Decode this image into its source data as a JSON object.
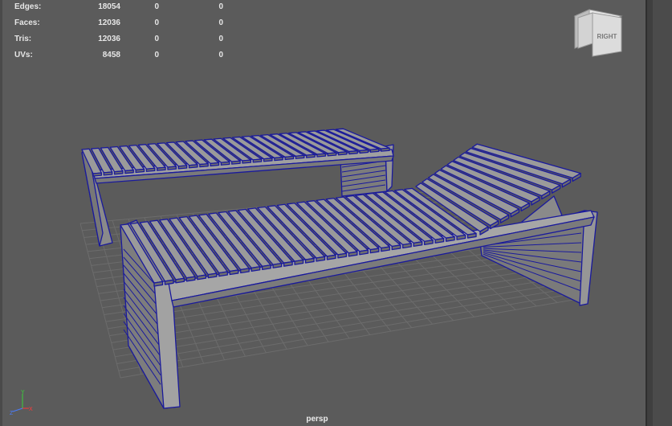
{
  "hud": {
    "rows": [
      {
        "label": "Edges:",
        "v1": "18054",
        "v2": "0",
        "v3": "0"
      },
      {
        "label": "Faces:",
        "v1": "12036",
        "v2": "0",
        "v3": "0"
      },
      {
        "label": "Tris:",
        "v1": "12036",
        "v2": "0",
        "v3": "0"
      },
      {
        "label": "UVs:",
        "v1": "8458",
        "v2": "0",
        "v3": "0"
      }
    ]
  },
  "viewcube": {
    "face_label": "RIGHT"
  },
  "camera": {
    "label": "persp"
  },
  "colors": {
    "wireframe": "#1a1a9c",
    "surface": "#8a8a8a",
    "grid": "#6c6c6c",
    "background": "#5b5b5b"
  }
}
